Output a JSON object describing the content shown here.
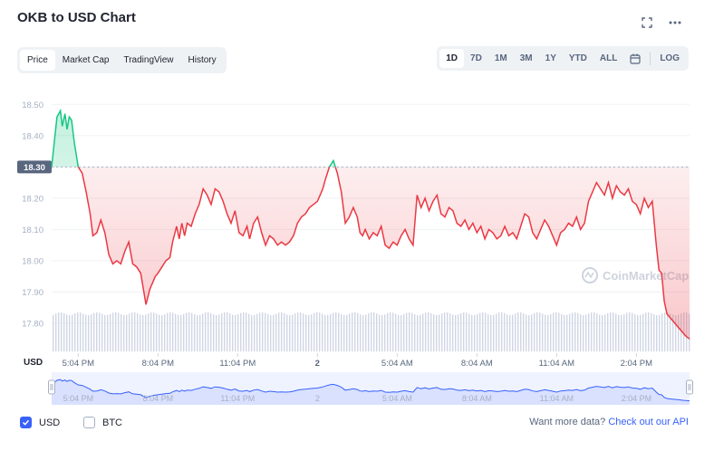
{
  "header": {
    "title": "OKB to USD Chart"
  },
  "tabs": [
    "Price",
    "Market Cap",
    "TradingView",
    "History"
  ],
  "active_tab": 0,
  "ranges": [
    "1D",
    "7D",
    "1M",
    "3M",
    "1Y",
    "YTD",
    "ALL"
  ],
  "active_range": 0,
  "log_label": "LOG",
  "watermark": "CoinMarketCap",
  "currency_label": "USD",
  "legend": [
    {
      "label": "USD",
      "checked": true
    },
    {
      "label": "BTC",
      "checked": false
    }
  ],
  "api": {
    "text": "Want more data?",
    "link": "Check out our API"
  },
  "colors": {
    "up": "#16c784",
    "down": "#ea3943",
    "navigator": "#3861fb",
    "volume": "#cfd6e4"
  },
  "chart_data": {
    "type": "line",
    "ylabel": "USD",
    "ylim": [
      17.8,
      18.55
    ],
    "yticks": [
      "18.50",
      "18.40",
      "18.30",
      "18.20",
      "18.10",
      "18.00",
      "17.90",
      "17.80"
    ],
    "reference_price": "18.30",
    "x_tick_labels": [
      "5:04 PM",
      "8:04 PM",
      "11:04 PM",
      "2",
      "5:04 AM",
      "8:04 AM",
      "11:04 AM",
      "2:04 PM"
    ],
    "x_tick_hours": [
      1,
      4,
      7,
      10,
      13,
      16,
      19,
      22
    ],
    "x_range_hours": [
      0,
      24
    ],
    "series": [
      {
        "x": [
          0,
          0.2,
          0.33,
          0.4,
          0.5,
          0.58,
          0.66,
          0.75,
          0.85,
          1.0,
          1.15,
          1.3,
          1.45,
          1.55,
          1.7,
          1.85,
          2.0,
          2.15,
          2.3,
          2.45,
          2.6,
          2.75,
          2.9,
          3.05,
          3.2,
          3.35,
          3.45,
          3.55,
          3.7,
          3.8,
          3.9,
          4.0,
          4.15,
          4.3,
          4.45,
          4.55,
          4.7,
          4.8,
          4.9,
          5.0,
          5.1,
          5.25,
          5.4,
          5.55,
          5.7,
          5.85,
          6.0,
          6.15,
          6.3,
          6.45,
          6.6,
          6.75,
          6.9,
          7.05,
          7.2,
          7.35,
          7.45,
          7.6,
          7.75,
          7.9,
          8.05,
          8.2,
          8.35,
          8.5,
          8.65,
          8.8,
          8.95,
          9.1,
          9.25,
          9.4,
          9.55,
          9.7,
          9.85,
          10.0,
          10.1,
          10.2,
          10.3,
          10.45,
          10.6,
          10.75,
          10.9,
          11.05,
          11.2,
          11.35,
          11.5,
          11.6,
          11.7,
          11.8,
          11.95,
          12.1,
          12.25,
          12.4,
          12.55,
          12.7,
          12.85,
          13.0,
          13.15,
          13.3,
          13.45,
          13.6,
          13.75,
          13.9,
          14.05,
          14.2,
          14.35,
          14.5,
          14.65,
          14.8,
          14.95,
          15.1,
          15.25,
          15.4,
          15.55,
          15.7,
          15.85,
          16.0,
          16.15,
          16.3,
          16.45,
          16.6,
          16.75,
          16.9,
          17.05,
          17.2,
          17.35,
          17.5,
          17.65,
          17.8,
          17.95,
          18.1,
          18.25,
          18.4,
          18.55,
          18.7,
          18.85,
          19.0,
          19.15,
          19.3,
          19.45,
          19.6,
          19.75,
          19.9,
          20.05,
          20.2,
          20.35,
          20.5,
          20.65,
          20.8,
          20.95,
          21.1,
          21.25,
          21.4,
          21.55,
          21.7,
          21.85,
          22.0,
          22.15,
          22.3,
          22.45,
          22.6,
          22.75,
          22.85,
          22.95,
          23.05,
          23.15,
          23.25,
          23.35,
          23.45,
          23.55,
          23.65,
          23.75,
          23.85,
          24.0
        ],
        "values": [
          18.3,
          18.46,
          18.48,
          18.43,
          18.47,
          18.42,
          18.46,
          18.45,
          18.38,
          18.3,
          18.28,
          18.22,
          18.15,
          18.08,
          18.09,
          18.13,
          18.09,
          18.02,
          17.99,
          18.0,
          17.99,
          18.03,
          18.06,
          17.99,
          17.98,
          17.96,
          17.91,
          17.86,
          17.91,
          17.93,
          17.95,
          17.96,
          17.98,
          18.0,
          18.01,
          18.06,
          18.11,
          18.07,
          18.12,
          18.08,
          18.12,
          18.11,
          18.15,
          18.18,
          18.23,
          18.21,
          18.18,
          18.23,
          18.22,
          18.19,
          18.15,
          18.12,
          18.16,
          18.09,
          18.08,
          18.11,
          18.07,
          18.12,
          18.14,
          18.09,
          18.05,
          18.08,
          18.07,
          18.05,
          18.06,
          18.05,
          18.06,
          18.08,
          18.12,
          18.14,
          18.15,
          18.17,
          18.18,
          18.19,
          18.21,
          18.23,
          18.26,
          18.3,
          18.32,
          18.28,
          18.22,
          18.12,
          18.14,
          18.17,
          18.14,
          18.09,
          18.08,
          18.1,
          18.07,
          18.09,
          18.08,
          18.11,
          18.05,
          18.04,
          18.06,
          18.05,
          18.08,
          18.1,
          18.07,
          18.05,
          18.21,
          18.17,
          18.2,
          18.16,
          18.19,
          18.21,
          18.15,
          18.14,
          18.17,
          18.16,
          18.12,
          18.11,
          18.13,
          18.1,
          18.12,
          18.09,
          18.11,
          18.07,
          18.1,
          18.09,
          18.07,
          18.08,
          18.11,
          18.08,
          18.09,
          18.07,
          18.11,
          18.15,
          18.14,
          18.09,
          18.07,
          18.1,
          18.13,
          18.11,
          18.08,
          18.05,
          18.09,
          18.1,
          18.12,
          18.11,
          18.14,
          18.1,
          18.12,
          18.19,
          18.22,
          18.25,
          18.23,
          18.21,
          18.25,
          18.2,
          18.24,
          18.22,
          18.21,
          18.23,
          18.19,
          18.18,
          18.15,
          18.2,
          18.17,
          18.19,
          18.05,
          17.97,
          17.96,
          17.87,
          17.83,
          17.82,
          17.81,
          17.8,
          17.79,
          17.78,
          17.77,
          17.76,
          17.75
        ]
      }
    ]
  }
}
